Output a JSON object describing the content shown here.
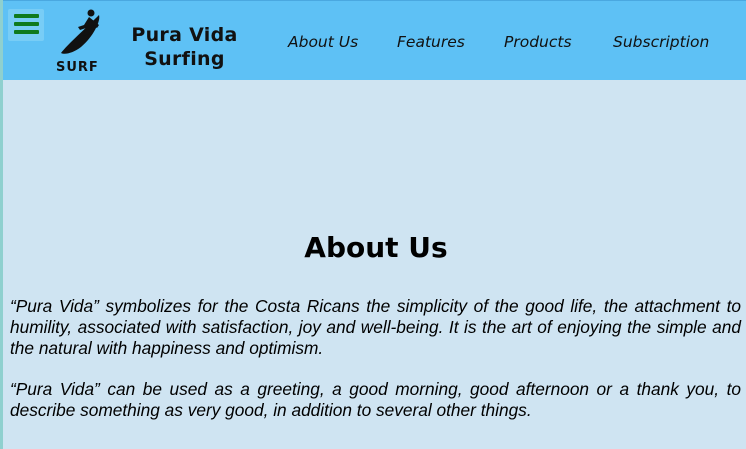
{
  "header": {
    "menu_icon": "hamburger-menu-icon",
    "logo_icon": "surfer-logo-icon",
    "logo_text": "SURF",
    "brand_line1": "Pura Vida",
    "brand_line2": "Surfing",
    "nav": [
      {
        "label": "About Us"
      },
      {
        "label": "Features"
      },
      {
        "label": "Products"
      },
      {
        "label": "Subscription"
      }
    ],
    "colors": {
      "header_bg": "#5ec1f5",
      "menu_icon": "#0f7a1e"
    }
  },
  "main": {
    "title": "About Us",
    "paragraphs": [
      "“Pura Vida” symbolizes for the Costa Ricans the simplicity of the good life, the attachment to humility, associated with satisfaction, joy and well-being. It is the art of enjoying the simple and the natural with happiness and optimism.",
      "“Pura Vida” can be used as a greeting, a good morning, good afternoon or a thank you, to describe something as very good, in addition to several other things."
    ],
    "colors": {
      "page_bg": "#cfe4f2"
    }
  }
}
